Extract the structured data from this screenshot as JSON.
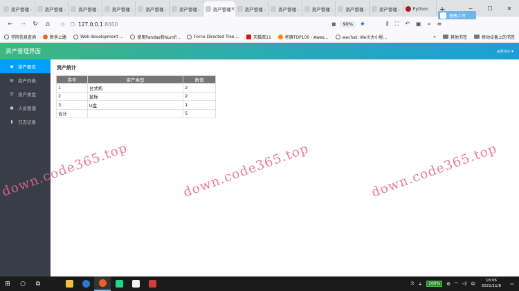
{
  "browser": {
    "tabs": [
      {
        "label": "资产管理 -"
      },
      {
        "label": "资产管理 -"
      },
      {
        "label": "资产管理 -"
      },
      {
        "label": "资产管理 -"
      },
      {
        "label": "资产管理 -"
      },
      {
        "label": "资产管理 -"
      },
      {
        "label": "资产管理"
      },
      {
        "label": "资产管理 -"
      },
      {
        "label": "资产管理 -"
      },
      {
        "label": "资产管理 -"
      },
      {
        "label": "资产管理 -"
      },
      {
        "label": "资产管理 -"
      },
      {
        "label": "Python"
      }
    ],
    "active_tab_index": 6,
    "float_button_label": "拖拽上传",
    "url_host": "127.0.0.1",
    "url_port": ":8000",
    "zoom": "90%",
    "bookmarks": [
      {
        "label": "学院信息查询"
      },
      {
        "label": "新手上路"
      },
      {
        "label": "Web development ..."
      },
      {
        "label": "使用Pandas和NumP..."
      },
      {
        "label": "Force-Directed Tree ..."
      },
      {
        "label": "天猫双11"
      },
      {
        "label": "老旗TOP100 - Awes..."
      },
      {
        "label": "wechat: We川大小程..."
      }
    ],
    "other_bookmarks": "其他书签",
    "mobile_bookmarks": "移动设备上的书签"
  },
  "app": {
    "title": "资产管理界面",
    "user": "admin",
    "sidebar": [
      {
        "label": "资产概览",
        "icon": "dashboard-icon",
        "glyph": "◉",
        "active": true
      },
      {
        "label": "资产列表",
        "icon": "list-icon",
        "glyph": "▤",
        "active": false
      },
      {
        "label": "资产类型",
        "icon": "menu-icon",
        "glyph": "☰",
        "active": false
      },
      {
        "label": "人员管理",
        "icon": "user-icon",
        "glyph": "●",
        "active": false
      },
      {
        "label": "日志记录",
        "icon": "book-icon",
        "glyph": "▮",
        "active": false
      }
    ],
    "section_title": "资产统计",
    "table": {
      "headers": [
        "序号",
        "资产类型",
        "数值"
      ],
      "rows": [
        [
          "1",
          "台式机",
          "2"
        ],
        [
          "2",
          "鼠标",
          "2"
        ],
        [
          "3",
          "U盘",
          "1"
        ]
      ],
      "total": [
        "合计",
        "",
        "5"
      ]
    }
  },
  "watermark": "down.code365.top",
  "taskbar": {
    "battery": "100%",
    "ime": "中",
    "time": "18:06",
    "date": "2021/11/8"
  }
}
